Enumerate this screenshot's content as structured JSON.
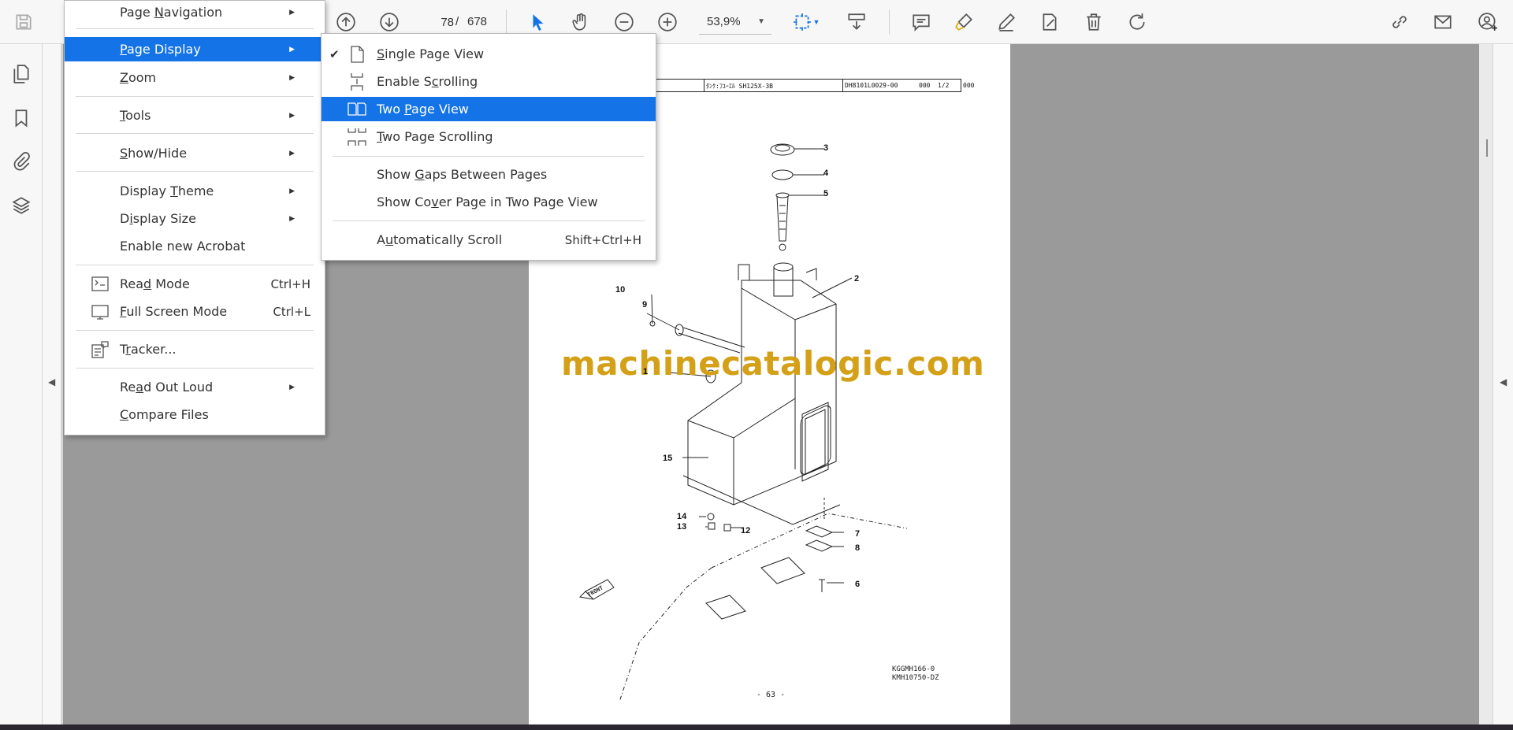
{
  "toolbar": {
    "current_page": "78",
    "page_separator": "/",
    "total_pages": "678",
    "zoom_level": "53,9%",
    "accent_color": "#1473e6"
  },
  "view_menu": {
    "items": [
      {
        "label": "Page Navigation",
        "underline": "N",
        "submenu": true,
        "shortcut": ""
      },
      {
        "label": "Page Display",
        "underline": "P",
        "submenu": true,
        "shortcut": "",
        "highlighted": true
      },
      {
        "label": "Zoom",
        "underline": "Z",
        "submenu": true,
        "shortcut": ""
      },
      {
        "label": "Tools",
        "underline": "T",
        "submenu": true,
        "shortcut": ""
      },
      {
        "label": "Show/Hide",
        "underline": "S",
        "submenu": true,
        "shortcut": ""
      },
      {
        "label": "Display Theme",
        "underline": "T",
        "submenu": true,
        "shortcut": ""
      },
      {
        "label": "Display Size",
        "underline": "i",
        "submenu": true,
        "shortcut": ""
      },
      {
        "label": "Enable new Acrobat",
        "underline": "",
        "submenu": false,
        "shortcut": ""
      },
      {
        "label": "Read Mode",
        "underline": "d",
        "submenu": false,
        "shortcut": "Ctrl+H",
        "icon": "read-mode-icon"
      },
      {
        "label": "Full Screen Mode",
        "underline": "F",
        "submenu": false,
        "shortcut": "Ctrl+L",
        "icon": "full-screen-icon"
      },
      {
        "label": "Tracker...",
        "underline": "r",
        "submenu": false,
        "shortcut": "",
        "icon": "tracker-icon"
      },
      {
        "label": "Read Out Loud",
        "underline": "a",
        "submenu": true,
        "shortcut": ""
      },
      {
        "label": "Compare Files",
        "underline": "C",
        "submenu": false,
        "shortcut": ""
      }
    ]
  },
  "page_display_menu": {
    "items": [
      {
        "label": "Single Page View",
        "underline": "S",
        "shortcut": "",
        "checked": true,
        "icon": "single-page-icon"
      },
      {
        "label": "Enable Scrolling",
        "underline": "c",
        "shortcut": "",
        "icon": "enable-scrolling-icon"
      },
      {
        "label": "Two Page View",
        "underline": "P",
        "shortcut": "",
        "highlighted": true,
        "icon": "two-page-icon"
      },
      {
        "label": "Two Page Scrolling",
        "underline": "T",
        "shortcut": "",
        "icon": "two-page-scrolling-icon"
      },
      {
        "label": "Show Gaps Between Pages",
        "underline": "G",
        "shortcut": ""
      },
      {
        "label": "Show Cover Page in Two Page View",
        "underline": "v",
        "shortcut": ""
      },
      {
        "label": "Automatically Scroll",
        "underline": "u",
        "shortcut": "Shift+Ctrl+H"
      }
    ]
  },
  "document": {
    "header_title": "ﾀﾝｸ:ﾌﾕｰｴﾙ SH125X-3B",
    "header_code": "DH8101L0029-00",
    "header_rev": "000",
    "header_sheet": "1/2",
    "header_outside": "000",
    "watermark": "machinecatalogic.com",
    "callouts": [
      "3",
      "4",
      "5",
      "2",
      "10",
      "9",
      "1",
      "15",
      "14",
      "13",
      "12",
      "7",
      "8",
      "6"
    ],
    "front_label": "FRONT",
    "ref_codes": [
      "KGGMH166-0",
      "KMH10750-DZ"
    ],
    "page_footer": "- 63 -"
  }
}
